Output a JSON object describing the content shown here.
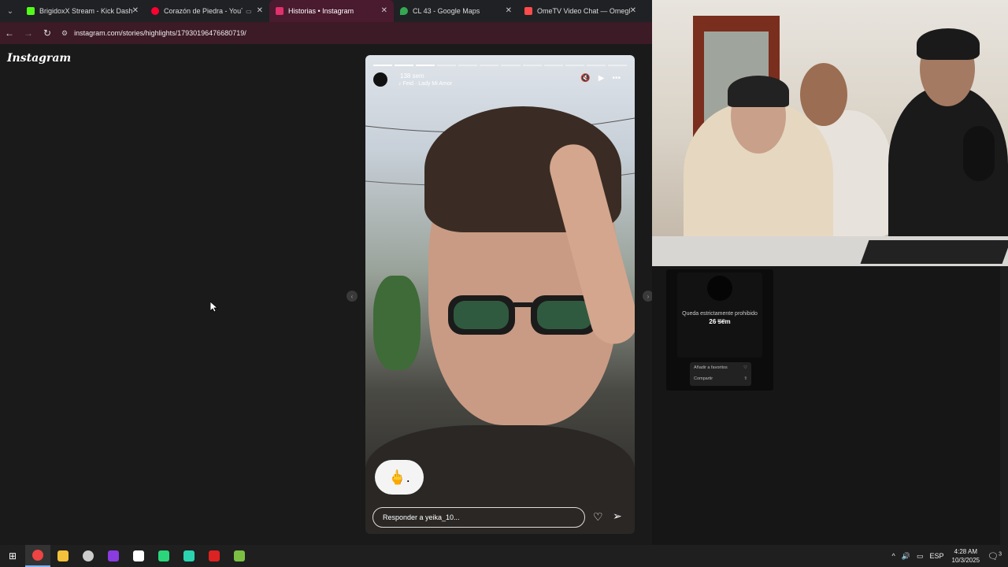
{
  "browser": {
    "tabs": [
      {
        "label": "BrigidoxX Stream - Kick Dashbo",
        "icon": "kick-icon",
        "color": "#53fc18",
        "active": false
      },
      {
        "label": "Corazón de Piedra - YouTub",
        "icon": "youtube-icon",
        "color": "#ff0033",
        "active": false
      },
      {
        "label": "Historias • Instagram",
        "icon": "instagram-icon",
        "color": "#e1306c",
        "active": true
      },
      {
        "label": "CL 43 - Google Maps",
        "icon": "maps-icon",
        "color": "#34a853",
        "active": false
      },
      {
        "label": "OmeTV Video Chat — Omegle",
        "icon": "ometv-icon",
        "color": "#ff4b4b",
        "active": false
      }
    ],
    "url": "instagram.com/stories/highlights/17930196476680719/"
  },
  "instagram": {
    "logo": "Instagram",
    "story": {
      "time": "138 sem",
      "song": "Feid · Lady Mi Amor",
      "progress_total": 12,
      "progress_done": 3,
      "emoji": "🖕.",
      "reply_placeholder": "Responder a yeika_10..."
    },
    "thumb": {
      "text": "Queda estrictamente prohibido ...rse.",
      "badge": "26 sem",
      "menu": [
        {
          "label": "Añadir a favoritos",
          "icon": "♡"
        },
        {
          "label": "Compartir",
          "icon": "⇧"
        }
      ]
    }
  },
  "taskbar": {
    "lang": "ESP",
    "time": "4:28 AM",
    "date": "10/3/2025",
    "notifications": "3"
  }
}
